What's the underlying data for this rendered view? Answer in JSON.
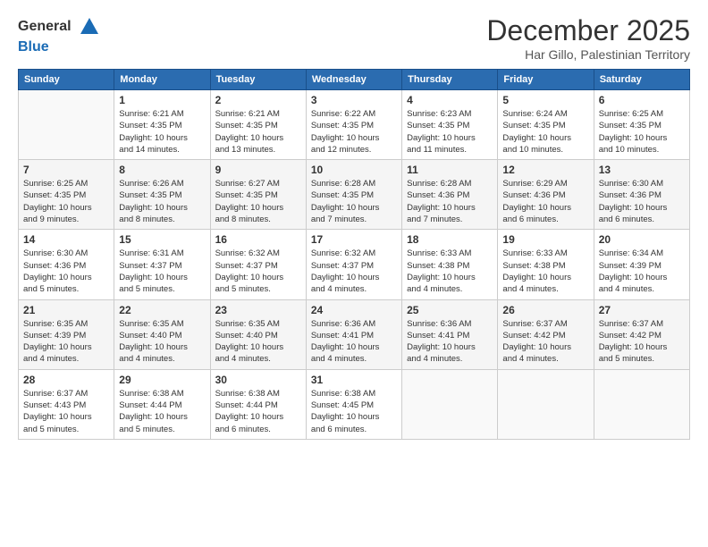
{
  "header": {
    "logo_line1": "General",
    "logo_line2": "Blue",
    "month_title": "December 2025",
    "location": "Har Gillo, Palestinian Territory"
  },
  "calendar": {
    "days_of_week": [
      "Sunday",
      "Monday",
      "Tuesday",
      "Wednesday",
      "Thursday",
      "Friday",
      "Saturday"
    ],
    "weeks": [
      [
        {
          "day": "",
          "info": ""
        },
        {
          "day": "1",
          "info": "Sunrise: 6:21 AM\nSunset: 4:35 PM\nDaylight: 10 hours\nand 14 minutes."
        },
        {
          "day": "2",
          "info": "Sunrise: 6:21 AM\nSunset: 4:35 PM\nDaylight: 10 hours\nand 13 minutes."
        },
        {
          "day": "3",
          "info": "Sunrise: 6:22 AM\nSunset: 4:35 PM\nDaylight: 10 hours\nand 12 minutes."
        },
        {
          "day": "4",
          "info": "Sunrise: 6:23 AM\nSunset: 4:35 PM\nDaylight: 10 hours\nand 11 minutes."
        },
        {
          "day": "5",
          "info": "Sunrise: 6:24 AM\nSunset: 4:35 PM\nDaylight: 10 hours\nand 10 minutes."
        },
        {
          "day": "6",
          "info": "Sunrise: 6:25 AM\nSunset: 4:35 PM\nDaylight: 10 hours\nand 10 minutes."
        }
      ],
      [
        {
          "day": "7",
          "info": "Sunrise: 6:25 AM\nSunset: 4:35 PM\nDaylight: 10 hours\nand 9 minutes."
        },
        {
          "day": "8",
          "info": "Sunrise: 6:26 AM\nSunset: 4:35 PM\nDaylight: 10 hours\nand 8 minutes."
        },
        {
          "day": "9",
          "info": "Sunrise: 6:27 AM\nSunset: 4:35 PM\nDaylight: 10 hours\nand 8 minutes."
        },
        {
          "day": "10",
          "info": "Sunrise: 6:28 AM\nSunset: 4:35 PM\nDaylight: 10 hours\nand 7 minutes."
        },
        {
          "day": "11",
          "info": "Sunrise: 6:28 AM\nSunset: 4:36 PM\nDaylight: 10 hours\nand 7 minutes."
        },
        {
          "day": "12",
          "info": "Sunrise: 6:29 AM\nSunset: 4:36 PM\nDaylight: 10 hours\nand 6 minutes."
        },
        {
          "day": "13",
          "info": "Sunrise: 6:30 AM\nSunset: 4:36 PM\nDaylight: 10 hours\nand 6 minutes."
        }
      ],
      [
        {
          "day": "14",
          "info": "Sunrise: 6:30 AM\nSunset: 4:36 PM\nDaylight: 10 hours\nand 5 minutes."
        },
        {
          "day": "15",
          "info": "Sunrise: 6:31 AM\nSunset: 4:37 PM\nDaylight: 10 hours\nand 5 minutes."
        },
        {
          "day": "16",
          "info": "Sunrise: 6:32 AM\nSunset: 4:37 PM\nDaylight: 10 hours\nand 5 minutes."
        },
        {
          "day": "17",
          "info": "Sunrise: 6:32 AM\nSunset: 4:37 PM\nDaylight: 10 hours\nand 4 minutes."
        },
        {
          "day": "18",
          "info": "Sunrise: 6:33 AM\nSunset: 4:38 PM\nDaylight: 10 hours\nand 4 minutes."
        },
        {
          "day": "19",
          "info": "Sunrise: 6:33 AM\nSunset: 4:38 PM\nDaylight: 10 hours\nand 4 minutes."
        },
        {
          "day": "20",
          "info": "Sunrise: 6:34 AM\nSunset: 4:39 PM\nDaylight: 10 hours\nand 4 minutes."
        }
      ],
      [
        {
          "day": "21",
          "info": "Sunrise: 6:35 AM\nSunset: 4:39 PM\nDaylight: 10 hours\nand 4 minutes."
        },
        {
          "day": "22",
          "info": "Sunrise: 6:35 AM\nSunset: 4:40 PM\nDaylight: 10 hours\nand 4 minutes."
        },
        {
          "day": "23",
          "info": "Sunrise: 6:35 AM\nSunset: 4:40 PM\nDaylight: 10 hours\nand 4 minutes."
        },
        {
          "day": "24",
          "info": "Sunrise: 6:36 AM\nSunset: 4:41 PM\nDaylight: 10 hours\nand 4 minutes."
        },
        {
          "day": "25",
          "info": "Sunrise: 6:36 AM\nSunset: 4:41 PM\nDaylight: 10 hours\nand 4 minutes."
        },
        {
          "day": "26",
          "info": "Sunrise: 6:37 AM\nSunset: 4:42 PM\nDaylight: 10 hours\nand 4 minutes."
        },
        {
          "day": "27",
          "info": "Sunrise: 6:37 AM\nSunset: 4:42 PM\nDaylight: 10 hours\nand 5 minutes."
        }
      ],
      [
        {
          "day": "28",
          "info": "Sunrise: 6:37 AM\nSunset: 4:43 PM\nDaylight: 10 hours\nand 5 minutes."
        },
        {
          "day": "29",
          "info": "Sunrise: 6:38 AM\nSunset: 4:44 PM\nDaylight: 10 hours\nand 5 minutes."
        },
        {
          "day": "30",
          "info": "Sunrise: 6:38 AM\nSunset: 4:44 PM\nDaylight: 10 hours\nand 6 minutes."
        },
        {
          "day": "31",
          "info": "Sunrise: 6:38 AM\nSunset: 4:45 PM\nDaylight: 10 hours\nand 6 minutes."
        },
        {
          "day": "",
          "info": ""
        },
        {
          "day": "",
          "info": ""
        },
        {
          "day": "",
          "info": ""
        }
      ]
    ]
  },
  "colors": {
    "header_bg": "#2b6cb0",
    "accent_blue": "#1a6bb5"
  }
}
